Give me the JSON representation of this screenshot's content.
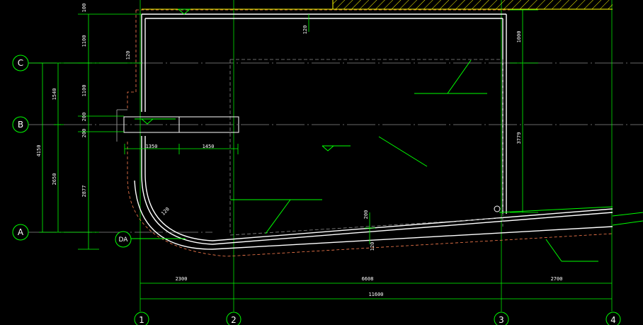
{
  "axes": {
    "rows": [
      "C",
      "B",
      "A"
    ],
    "cols": [
      "1",
      "2",
      "3",
      "4"
    ]
  },
  "tag": "DA",
  "dims": {
    "bottom_seg1": "2300",
    "bottom_seg2": "6608",
    "bottom_seg3": "2700",
    "bottom_total": "11600",
    "left_1100_top": "1100",
    "left_1100_mid": "1100",
    "left_1540": "1540",
    "left_200_a": "200",
    "left_200_b": "200",
    "left_4150": "4150",
    "left_2650": "2650",
    "left_2877": "2877",
    "top_100": "100",
    "right_1000": "1000",
    "right_3779": "3779",
    "wall_120_top": "120",
    "wall_120_left": "120",
    "wall_120_corner": "120",
    "beam_1350": "1350",
    "beam_1450": "1450",
    "slab_200": "200",
    "slab_120": "120"
  },
  "colors": {
    "green": "#00ff00",
    "white": "#ffffff",
    "red_dash": "#ff7f50",
    "gray": "#8c8c8c",
    "yellow": "#ffff00"
  }
}
